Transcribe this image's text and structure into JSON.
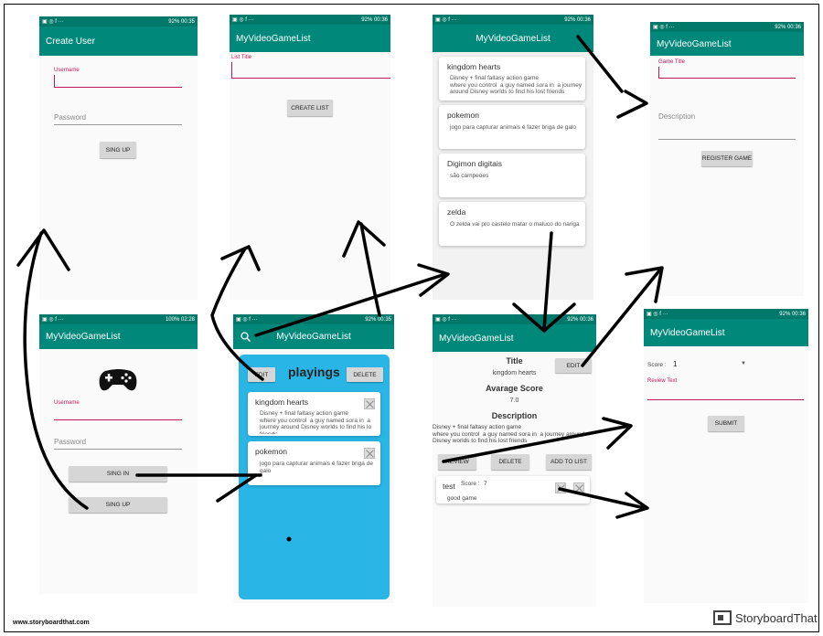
{
  "status": {
    "icons_left": "▣ ◎ f  ···",
    "p1_right": "92% 00:35",
    "p2_right": "92% 00:36",
    "p3_right": "92% 00:36",
    "p4_right": "92% 00:36",
    "p5_right": "100% 02:28",
    "p6_right": "92% 00:35",
    "p7_right": "92% 00:36",
    "p8_right": "92% 00:36"
  },
  "create_user": {
    "title": "Create User",
    "username_label": "Username",
    "password_placeholder": "Password",
    "signup_button": "SING UP"
  },
  "create_list": {
    "title": "MyVideoGameList",
    "list_title_label": "List Title",
    "create_button": "CREATE LIST"
  },
  "games_list": {
    "title": "MyVideoGameList",
    "items": [
      {
        "title": "kingdom hearts",
        "desc": "Disney + final faltasy action game\nwhere you control  a guy named sora in  a journey\naround Disney worlds to find his lost friends"
      },
      {
        "title": "pokemon",
        "desc": "jogo para capturar animais é fazer briga de galo"
      },
      {
        "title": "Digimon digitais",
        "desc": "são campeoes"
      },
      {
        "title": "zelda",
        "desc": "O zelda vai pro castelo matar o maluco do nariga"
      }
    ]
  },
  "register_game": {
    "title": "MyVideoGameList",
    "game_title_label": "Game Title",
    "description_placeholder": "Description",
    "register_button": "REGISTER GAME"
  },
  "login": {
    "title": "MyVideoGameList",
    "username_label": "Username",
    "password_placeholder": "Password",
    "signin_button": "SING IN",
    "signup_button": "SING UP"
  },
  "list_view": {
    "title": "MyVideoGameList",
    "list_name": "playings",
    "edit_button": "EDIT",
    "delete_button": "DELETE",
    "items": [
      {
        "title": "kingdom hearts",
        "desc": "Disney + final faltasy action game\nwhere you control  a guy named sora in  a\njourney around Disney worlds to find his lo\nfriends"
      },
      {
        "title": "pokemon",
        "desc": "jogo para capturar animais é fazer briga de\ngalo"
      }
    ]
  },
  "game_detail": {
    "title": "MyVideoGameList",
    "title_heading": "Title",
    "title_value": "kingdom hearts",
    "score_heading": "Avarage Score",
    "score_value": "7.0",
    "desc_heading": "Description",
    "desc_value": "Disney + final faltasy action game\nwhere you control  a guy named sora in  a journey around\nDisney worlds to find his lost friends",
    "edit_button": "EDIT",
    "review_button": "REVIEW",
    "delete_button": "DELETE",
    "add_button": "ADD TO LIST",
    "review": {
      "user": "test",
      "score_label": "Score :",
      "score": "7",
      "text": "good game"
    }
  },
  "review_form": {
    "title": "MyVideoGameList",
    "score_label": "Score :",
    "score_value": "1",
    "review_label": "Review Text",
    "submit_button": "SUBMIT"
  },
  "footer": {
    "left": "www.storyboardthat.com",
    "right": "StoryboardThat"
  },
  "colors": {
    "status": "#00796b",
    "appbar": "#00897b",
    "accent": "#c2185b",
    "list_bg": "#29b6e6"
  }
}
